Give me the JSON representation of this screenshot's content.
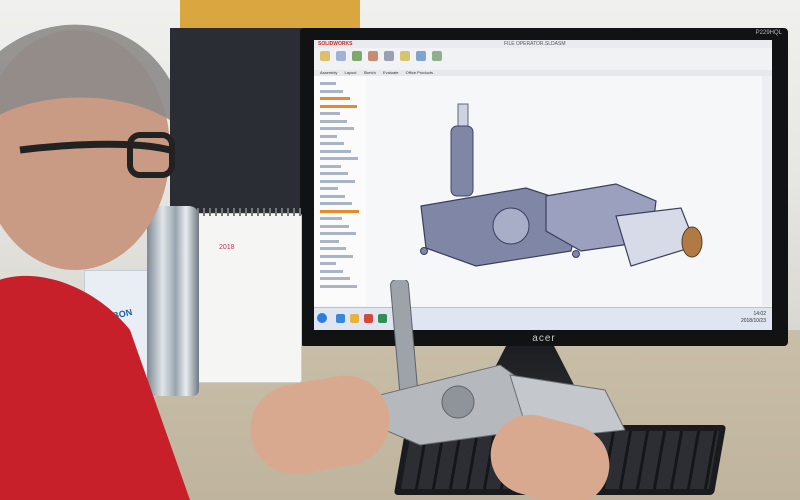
{
  "monitor": {
    "brand": "acer",
    "model": "P229HQL"
  },
  "cad": {
    "app_logo": "SOLIDWORKS",
    "file_title": "FILE OPERATOR.SLDASM",
    "tabs": [
      "Assembly",
      "Layout",
      "Sketch",
      "Evaluate",
      "Office Products"
    ],
    "tree_nodes": 28,
    "taskbar_clock": {
      "time": "14:02",
      "date": "2018/10/23"
    }
  },
  "desk": {
    "calendar_month": "2018",
    "box_label": "CARBON"
  },
  "colors": {
    "cad_model": "#7f86a6",
    "cad_model_light": "#a8aec8",
    "motor_orange": "#b07a45",
    "shirt_red": "#c8202a",
    "skin": "#d7a58c"
  }
}
